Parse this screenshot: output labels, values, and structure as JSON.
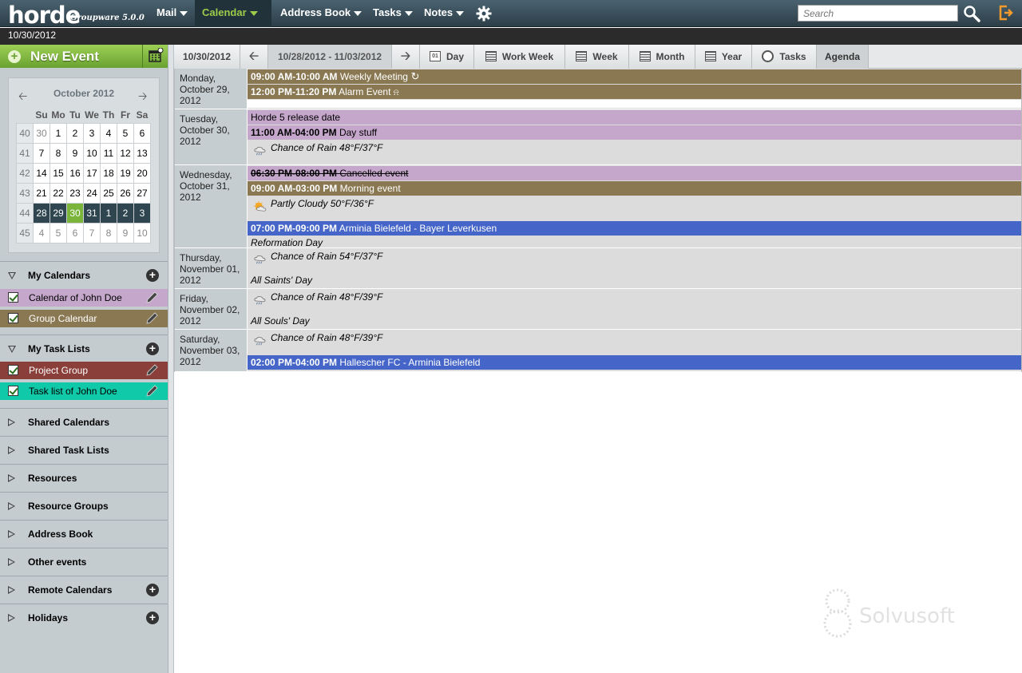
{
  "app": {
    "logo": "horde",
    "subtitle": "Groupware 5.0.0"
  },
  "menu": [
    {
      "label": "Mail",
      "active": false
    },
    {
      "label": "Calendar",
      "active": true
    },
    {
      "label": "Address Book",
      "active": false
    },
    {
      "label": "Tasks",
      "active": false
    },
    {
      "label": "Notes",
      "active": false
    }
  ],
  "search": {
    "placeholder": "Search"
  },
  "date_bar": "10/30/2012",
  "sidebar": {
    "new_event_label": "New Event",
    "minical": {
      "month": "October 2012",
      "day_headers": [
        "Su",
        "Mo",
        "Tu",
        "We",
        "Th",
        "Fr",
        "Sa"
      ],
      "weeks": [
        {
          "wk": "40",
          "days": [
            "30",
            "1",
            "2",
            "3",
            "4",
            "5",
            "6"
          ]
        },
        {
          "wk": "41",
          "days": [
            "7",
            "8",
            "9",
            "10",
            "11",
            "12",
            "13"
          ]
        },
        {
          "wk": "42",
          "days": [
            "14",
            "15",
            "16",
            "17",
            "18",
            "19",
            "20"
          ]
        },
        {
          "wk": "43",
          "days": [
            "21",
            "22",
            "23",
            "24",
            "25",
            "26",
            "27"
          ]
        },
        {
          "wk": "44",
          "days": [
            "28",
            "29",
            "30",
            "31",
            "1",
            "2",
            "3"
          ]
        },
        {
          "wk": "45",
          "days": [
            "4",
            "5",
            "6",
            "7",
            "8",
            "9",
            "10"
          ]
        }
      ],
      "today": "30"
    },
    "my_calendars_label": "My Calendars",
    "calendars": [
      {
        "label": "Calendar of John Doe",
        "color": "#c6a7cc",
        "text_color": "#000000"
      },
      {
        "label": "Group Calendar",
        "color": "#8a7852",
        "text_color": "#ffffff"
      }
    ],
    "my_task_lists_label": "My Task Lists",
    "task_lists": [
      {
        "label": "Project Group",
        "color": "#8b3f3a",
        "text_color": "#ffffff"
      },
      {
        "label": "Task list of John Doe",
        "color": "#10c9a8",
        "text_color": "#000000"
      }
    ],
    "sections": [
      {
        "label": "Shared Calendars",
        "add": false
      },
      {
        "label": "Shared Task Lists",
        "add": false
      },
      {
        "label": "Resources",
        "add": false
      },
      {
        "label": "Resource Groups",
        "add": false
      },
      {
        "label": "Address Book",
        "add": false
      },
      {
        "label": "Other events",
        "add": false
      },
      {
        "label": "Remote Calendars",
        "add": true
      },
      {
        "label": "Holidays",
        "add": true
      }
    ]
  },
  "toolbar": {
    "today": "10/30/2012",
    "range": "10/28/2012 - 11/03/2012",
    "views": [
      "Day",
      "Work Week",
      "Week",
      "Month",
      "Year",
      "Tasks",
      "Agenda"
    ],
    "active_view": "Agenda"
  },
  "agenda": [
    {
      "label": "Monday, October 29, 2012",
      "items": [
        {
          "kind": "event",
          "cal": "group",
          "time": "09:00 AM-10:00 AM",
          "title": "Weekly Meeting",
          "icon": "recurring-icon"
        },
        {
          "kind": "event",
          "cal": "group",
          "time": "12:00 PM-11:20 PM",
          "title": "Alarm Event",
          "icon": "bell-icon"
        }
      ]
    },
    {
      "label": "Tuesday, October 30, 2012",
      "items": [
        {
          "kind": "event",
          "cal": "john",
          "time": "",
          "title": "Horde 5 release date"
        },
        {
          "kind": "event",
          "cal": "john",
          "time": "11:00 AM-04:00 PM",
          "title": "Day stuff"
        },
        {
          "kind": "weather",
          "icon": "rain-icon",
          "text": "Chance of Rain 48°F/37°F"
        }
      ]
    },
    {
      "label": "Wednesday, October 31, 2012",
      "items": [
        {
          "kind": "event",
          "cal": "john",
          "time": "06:30 PM-08:00 PM",
          "title": "Cancelled event",
          "cancelled": true
        },
        {
          "kind": "event",
          "cal": "group",
          "time": "09:00 AM-03:00 PM",
          "title": "Morning event"
        },
        {
          "kind": "weather",
          "icon": "partly-cloudy-icon",
          "text": "Partly Cloudy 50°F/36°F"
        },
        {
          "kind": "event",
          "cal": "blue",
          "time": "07:00 PM-09:00 PM",
          "title": "Arminia Bielefeld - Bayer Leverkusen"
        },
        {
          "kind": "note",
          "text": "Reformation Day"
        }
      ]
    },
    {
      "label": "Thursday, November 01, 2012",
      "items": [
        {
          "kind": "weather",
          "icon": "rain-icon",
          "text": "Chance of Rain 54°F/37°F"
        },
        {
          "kind": "note",
          "text": "All Saints' Day"
        }
      ]
    },
    {
      "label": "Friday, November 02, 2012",
      "items": [
        {
          "kind": "weather",
          "icon": "rain-icon",
          "text": "Chance of Rain 48°F/39°F"
        },
        {
          "kind": "note",
          "text": "All Souls' Day"
        }
      ]
    },
    {
      "label": "Saturday, November 03, 2012",
      "items": [
        {
          "kind": "weather",
          "icon": "rain-icon",
          "text": "Chance of Rain 48°F/39°F"
        },
        {
          "kind": "event",
          "cal": "blue",
          "time": "02:00 PM-04:00 PM",
          "title": "Hallescher FC - Arminia Bielefeld"
        }
      ]
    }
  ],
  "watermark": "Solvusoft"
}
